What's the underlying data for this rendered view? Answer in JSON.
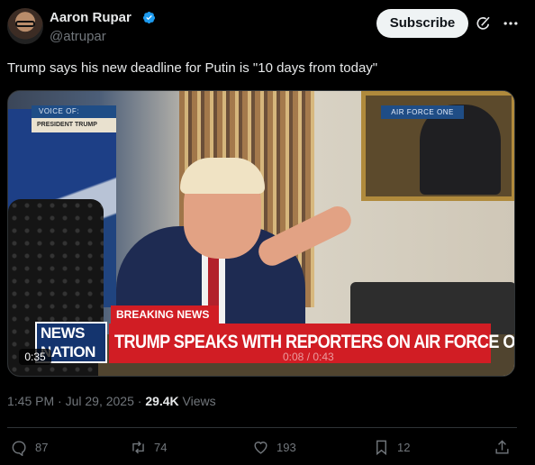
{
  "author": {
    "name": "Aaron Rupar",
    "handle": "@atrupar",
    "verified": true
  },
  "header": {
    "subscribe_label": "Subscribe"
  },
  "tweet": {
    "text": "Trump says his new deadline for Putin is \"10 days from today\"",
    "timestamp": "1:45 PM · Jul 29, 2025 · ",
    "views_count": "29.4K",
    "views_label": " Views"
  },
  "video": {
    "duration": "0:35",
    "playback_time": "0:08 / 0:43",
    "badge_voice_of": "VOICE OF:",
    "badge_president": "PRESIDENT TRUMP",
    "badge_air_force": "AIR FORCE ONE",
    "breaking_label": "BREAKING NEWS",
    "headline": "TRUMP SPEAKS WITH REPORTERS ON AIR FORCE ONE",
    "logo_line1": "NEWS",
    "logo_line2": "NATION"
  },
  "actions": {
    "replies": "87",
    "reposts": "74",
    "likes": "193",
    "bookmarks": "12"
  },
  "icons": {
    "verified": "verified-badge-icon",
    "grok": "grok-icon",
    "more": "more-icon",
    "reply": "reply-icon",
    "repost": "repost-icon",
    "like": "like-icon",
    "bookmark": "bookmark-icon",
    "share": "share-icon"
  },
  "colors": {
    "background": "#000000",
    "accent": "#1d9bf0",
    "muted": "#71767b",
    "news_red": "#d11d24"
  }
}
